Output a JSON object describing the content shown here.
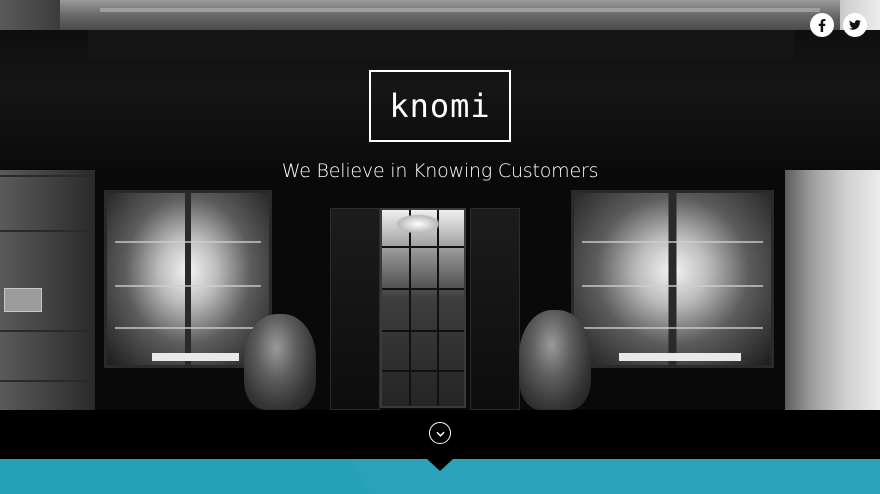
{
  "brand": {
    "logo_text": "knomi"
  },
  "hero": {
    "tagline": "We Believe in Knowing Customers"
  },
  "social": [
    {
      "name": "facebook-icon",
      "glyph": "f"
    },
    {
      "name": "twitter-icon",
      "glyph": "twitter-bird"
    }
  ],
  "scroll": {
    "icon": "chevron-down-icon"
  },
  "colors": {
    "accent_teal": "#2aa3b8",
    "band_black": "#000000",
    "text_white": "#ffffff"
  }
}
